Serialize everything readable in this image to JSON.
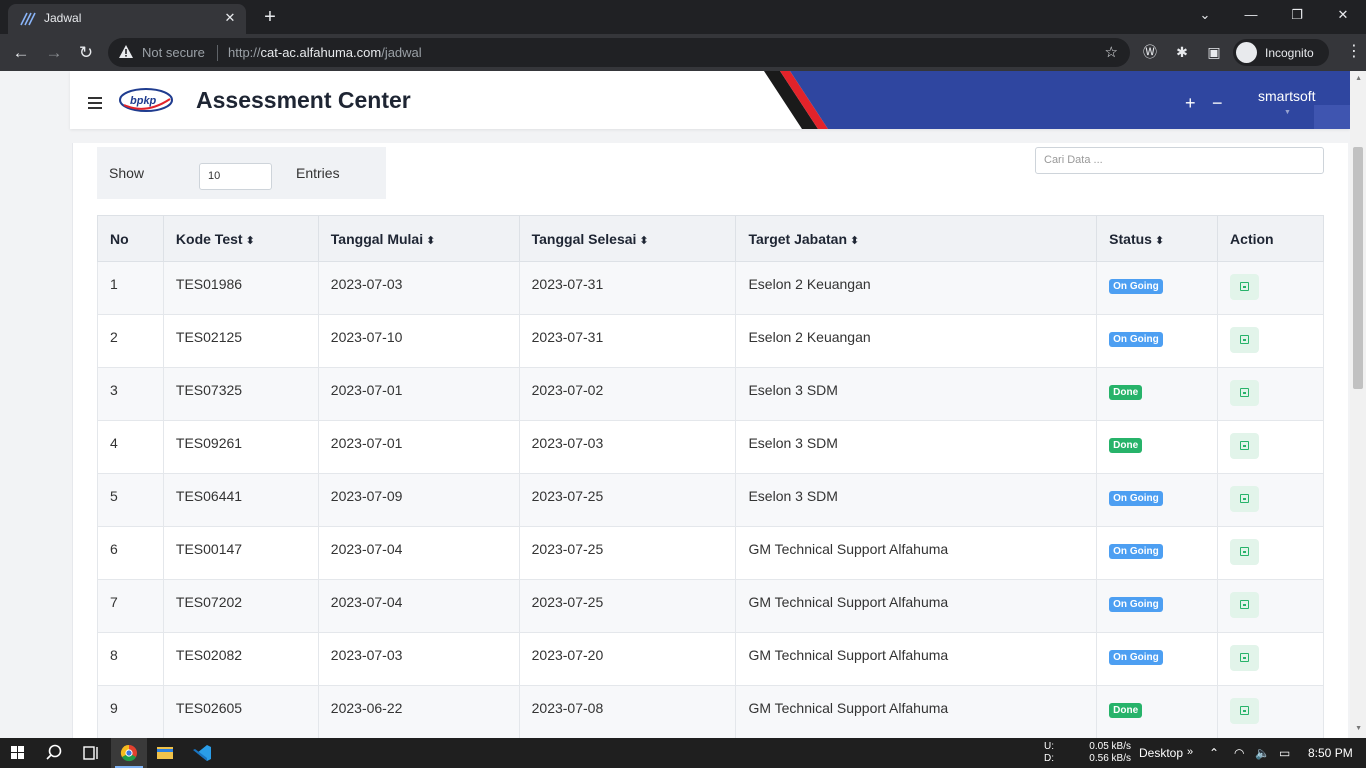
{
  "browser": {
    "tab_title": "Jadwal",
    "security_label": "Not secure",
    "url_prefix": "http://",
    "url_host": "cat-ac.alfahuma.com",
    "url_path": "/jadwal",
    "profile_label": "Incognito"
  },
  "header": {
    "logo_text": "bpkp",
    "title": "Assessment Center",
    "zoom_in": "+",
    "zoom_out": "−",
    "username": "smartsoft"
  },
  "controls": {
    "show_label": "Show",
    "page_length": "10",
    "entries_label": "Entries",
    "search_placeholder": "Cari Data ..."
  },
  "table": {
    "columns": [
      "No",
      "Kode Test",
      "Tanggal Mulai",
      "Tanggal Selesai",
      "Target Jabatan",
      "Status",
      "Action"
    ],
    "rows": [
      {
        "no": "1",
        "kode": "TES01986",
        "mulai": "2023-07-03",
        "selesai": "2023-07-31",
        "jabatan": "Eselon 2 Keuangan",
        "status": "On Going"
      },
      {
        "no": "2",
        "kode": "TES02125",
        "mulai": "2023-07-10",
        "selesai": "2023-07-31",
        "jabatan": "Eselon 2 Keuangan",
        "status": "On Going"
      },
      {
        "no": "3",
        "kode": "TES07325",
        "mulai": "2023-07-01",
        "selesai": "2023-07-02",
        "jabatan": "Eselon 3 SDM",
        "status": "Done"
      },
      {
        "no": "4",
        "kode": "TES09261",
        "mulai": "2023-07-01",
        "selesai": "2023-07-03",
        "jabatan": "Eselon 3 SDM",
        "status": "Done"
      },
      {
        "no": "5",
        "kode": "TES06441",
        "mulai": "2023-07-09",
        "selesai": "2023-07-25",
        "jabatan": "Eselon 3 SDM",
        "status": "On Going"
      },
      {
        "no": "6",
        "kode": "TES00147",
        "mulai": "2023-07-04",
        "selesai": "2023-07-25",
        "jabatan": "GM Technical Support Alfahuma",
        "status": "On Going"
      },
      {
        "no": "7",
        "kode": "TES07202",
        "mulai": "2023-07-04",
        "selesai": "2023-07-25",
        "jabatan": "GM Technical Support Alfahuma",
        "status": "On Going"
      },
      {
        "no": "8",
        "kode": "TES02082",
        "mulai": "2023-07-03",
        "selesai": "2023-07-20",
        "jabatan": "GM Technical Support Alfahuma",
        "status": "On Going"
      },
      {
        "no": "9",
        "kode": "TES02605",
        "mulai": "2023-06-22",
        "selesai": "2023-07-08",
        "jabatan": "GM Technical Support Alfahuma",
        "status": "Done"
      }
    ]
  },
  "taskbar": {
    "net_up_label": "U:",
    "net_down_label": "D:",
    "net_up": "0.05 kB/s",
    "net_down": "0.56 kB/s",
    "desktop_label": "Desktop",
    "clock": "8:50 PM"
  },
  "colors": {
    "brand_blue": "#2f46a0",
    "accent_red": "#e2232a",
    "status_ongoing": "#4d9ff2",
    "status_done": "#27b36a"
  }
}
